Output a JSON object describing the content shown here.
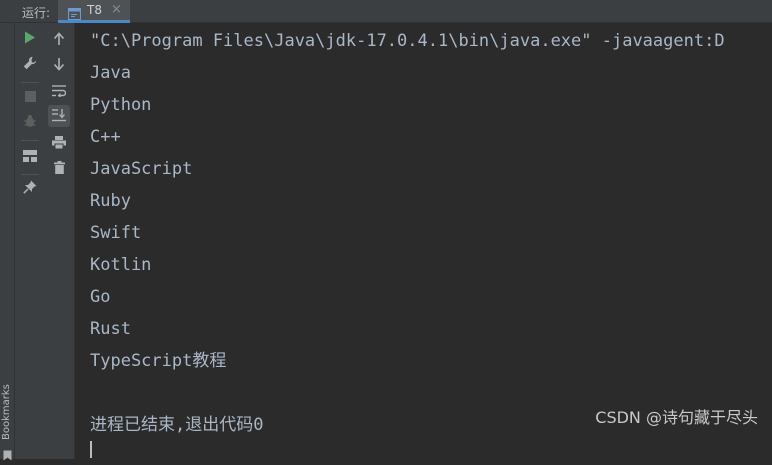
{
  "toolbar": {
    "run_label": "运行:",
    "tab_label": "T8",
    "tab_close": "×"
  },
  "sidebar": {
    "bookmarks_label": "Bookmarks"
  },
  "console": {
    "lines": [
      "\"C:\\Program Files\\Java\\jdk-17.0.4.1\\bin\\java.exe\" -javaagent:D",
      "Java",
      "Python",
      "C++",
      "JavaScript",
      "Ruby",
      "Swift",
      "Kotlin",
      "Go",
      "Rust",
      "TypeScript教程",
      "",
      "进程已结束,退出代码0"
    ]
  },
  "watermark": "CSDN @诗句藏于尽头",
  "colors": {
    "background": "#2b2b2b",
    "panel": "#3c3f41",
    "text": "#a9b7c6",
    "run_green": "#59a869",
    "accent_blue": "#4a88c7"
  }
}
